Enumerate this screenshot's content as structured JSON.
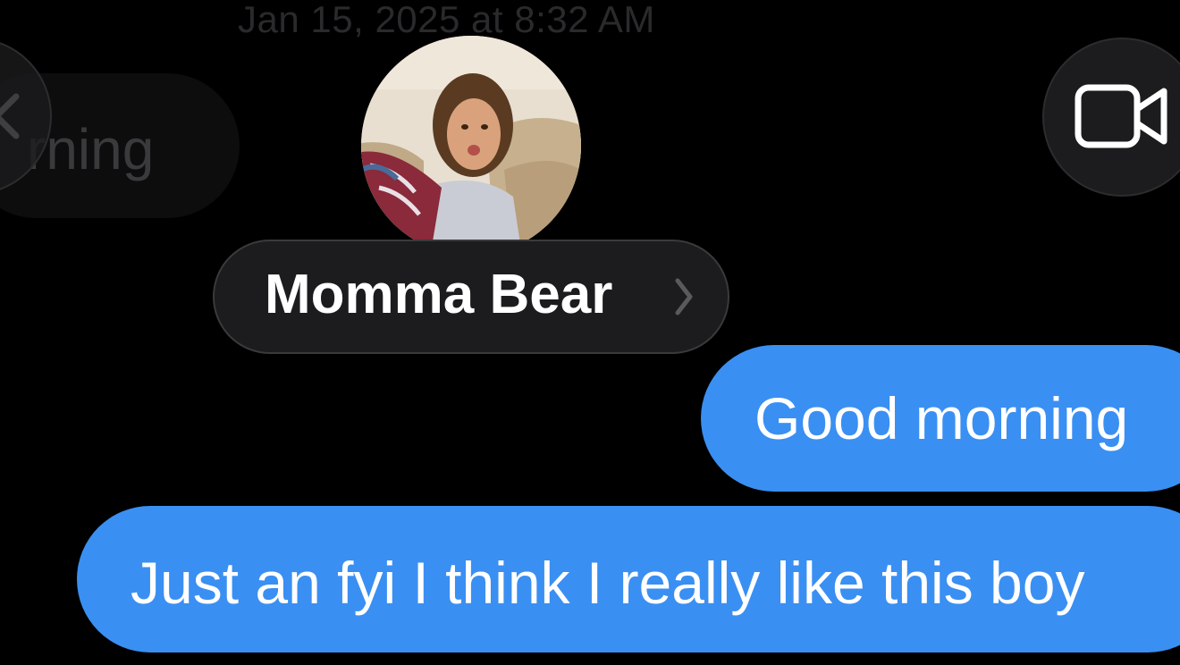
{
  "header": {
    "timestamp": "Jan 15, 2025 at 8:32 AM",
    "contact_name": "Momma Bear",
    "back_icon": "chevron-left-icon",
    "video_icon": "video-camera-icon"
  },
  "messages": [
    {
      "direction": "incoming",
      "text": "rning",
      "partially_hidden": true
    },
    {
      "direction": "outgoing",
      "text": "Good morning"
    },
    {
      "direction": "outgoing",
      "text": "Just an fyi I think I really like this boy"
    }
  ],
  "colors": {
    "background": "#000000",
    "outgoing_bubble": "#3a8ff2",
    "pill": "#1c1c1e"
  }
}
